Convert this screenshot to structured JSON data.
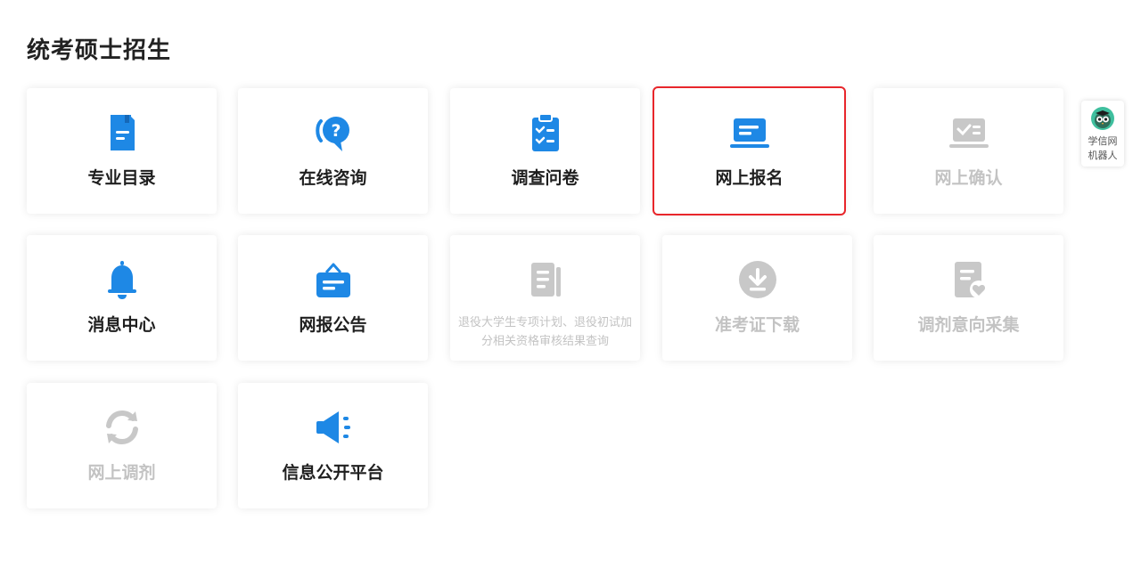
{
  "page": {
    "title": "统考硕士招生"
  },
  "colors": {
    "icon_active": "#1e88e5",
    "icon_disabled": "#c8c8c8",
    "highlight_border": "#e8262b"
  },
  "cards": [
    {
      "label": "专业目录",
      "icon": "document-icon",
      "enabled": true
    },
    {
      "label": "在线咨询",
      "icon": "question-chat-icon",
      "enabled": true
    },
    {
      "label": "调查问卷",
      "icon": "clipboard-check-icon",
      "enabled": true
    },
    {
      "label": "网上报名",
      "icon": "laptop-icon",
      "enabled": true,
      "highlighted": true
    },
    {
      "label": "网上确认",
      "icon": "laptop-check-icon",
      "enabled": false
    },
    {
      "label": "消息中心",
      "icon": "bell-icon",
      "enabled": true
    },
    {
      "label": "网报公告",
      "icon": "notice-board-icon",
      "enabled": true
    },
    {
      "label": "退役大学生专项计划、退役初试加分相关资格审核结果查询",
      "icon": "document-list-icon",
      "enabled": false
    },
    {
      "label": "准考证下载",
      "icon": "download-icon",
      "enabled": false
    },
    {
      "label": "调剂意向采集",
      "icon": "document-heart-icon",
      "enabled": false
    },
    {
      "label": "网上调剂",
      "icon": "refresh-icon",
      "enabled": false
    },
    {
      "label": "信息公开平台",
      "icon": "megaphone-icon",
      "enabled": true
    }
  ],
  "robot": {
    "label": "学信网机器人",
    "icon": "owl-avatar-icon"
  }
}
